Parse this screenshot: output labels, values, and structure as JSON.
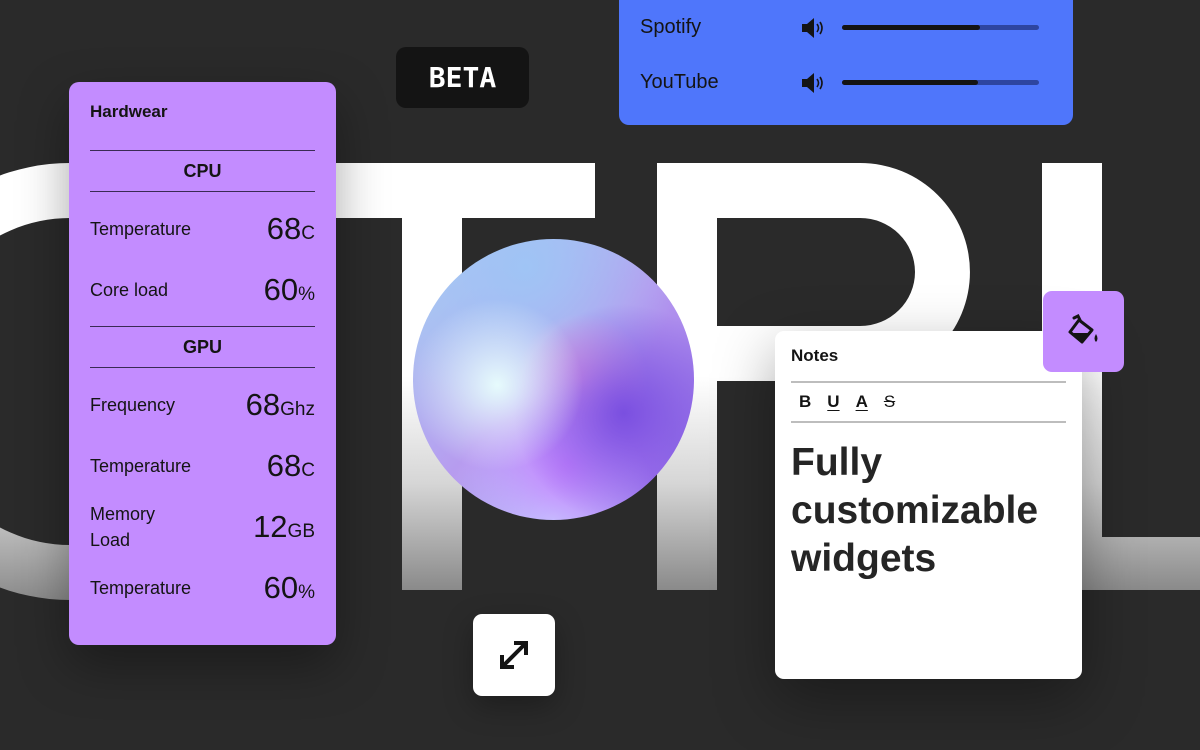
{
  "background_word": "CTRL",
  "beta_badge": "BETA",
  "hardware": {
    "title": "Hardwear",
    "sections": [
      {
        "name": "CPU",
        "rows": [
          {
            "label": "Temperature",
            "value": "68",
            "unit": "C"
          },
          {
            "label": "Core load",
            "value": "60",
            "unit": "%"
          }
        ]
      },
      {
        "name": "GPU",
        "rows": [
          {
            "label": "Frequency",
            "value": "68",
            "unit": "Ghz"
          },
          {
            "label": "Temperature",
            "value": "68",
            "unit": "C"
          },
          {
            "label": "Memory Load",
            "value": "12",
            "unit": "GB"
          },
          {
            "label": "Temperature",
            "value": "60",
            "unit": "%"
          }
        ]
      }
    ]
  },
  "media": {
    "apps": [
      {
        "name": "Spotify",
        "icon": "speaker-icon",
        "volume": 0.7
      },
      {
        "name": "YouTube",
        "icon": "speaker-icon",
        "volume": 0.69
      }
    ]
  },
  "notes": {
    "title": "Notes",
    "toolbar": {
      "bold": "B",
      "underline": "U",
      "text_color": "A",
      "strikethrough": "S"
    },
    "body": "Fully customizable widgets"
  },
  "icons": {
    "paint": "paint-bucket-icon",
    "expand": "expand-arrows-icon"
  },
  "colors": {
    "background": "#2a2a2a",
    "purple": "#c38cff",
    "blue": "#4f76fb",
    "dark": "#141414"
  }
}
